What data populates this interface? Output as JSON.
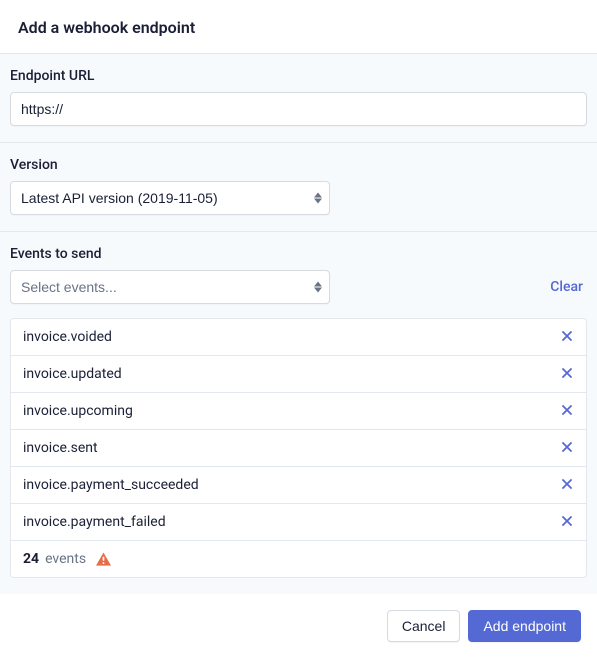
{
  "header": {
    "title": "Add a webhook endpoint"
  },
  "endpoint": {
    "label": "Endpoint URL",
    "value": "https://"
  },
  "version": {
    "label": "Version",
    "selected": "Latest API version (2019-11-05)"
  },
  "events": {
    "label": "Events to send",
    "select_placeholder": "Select events...",
    "clear_label": "Clear",
    "items": [
      "invoice.voided",
      "invoice.updated",
      "invoice.upcoming",
      "invoice.sent",
      "invoice.payment_succeeded",
      "invoice.payment_failed"
    ],
    "count": "24",
    "count_label": "events"
  },
  "footer": {
    "cancel": "Cancel",
    "submit": "Add endpoint"
  }
}
